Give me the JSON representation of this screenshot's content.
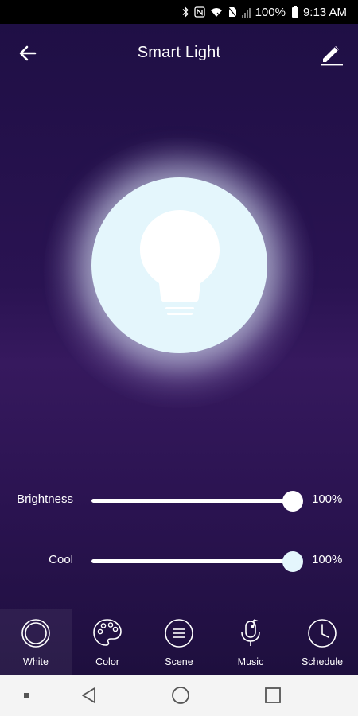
{
  "status_bar": {
    "battery": "100%",
    "time": "9:13 AM"
  },
  "header": {
    "title": "Smart Light",
    "back_icon": "arrow-left-icon",
    "edit_icon": "pencil-icon"
  },
  "bulb": {
    "icon": "lightbulb-icon",
    "color": "#e4f6fc"
  },
  "sliders": [
    {
      "label": "Brightness",
      "value_text": "100%",
      "value": 100,
      "thumb_color": "#ffffff"
    },
    {
      "label": "Cool",
      "value_text": "100%",
      "value": 100,
      "thumb_color": "#e4f6fc"
    }
  ],
  "tabs": [
    {
      "label": "White",
      "icon": "ring-icon",
      "active": true
    },
    {
      "label": "Color",
      "icon": "palette-icon",
      "active": false
    },
    {
      "label": "Scene",
      "icon": "scene-lines-icon",
      "active": false
    },
    {
      "label": "Music",
      "icon": "microphone-music-icon",
      "active": false
    },
    {
      "label": "Schedule",
      "icon": "clock-icon",
      "active": false
    }
  ],
  "system_nav": {
    "icons": [
      "dot-icon",
      "back-triangle-icon",
      "home-circle-icon",
      "recents-square-icon"
    ]
  },
  "colors": {
    "background_top": "#1f0f45",
    "background_mid": "#36195e",
    "accent": "#ffffff"
  }
}
